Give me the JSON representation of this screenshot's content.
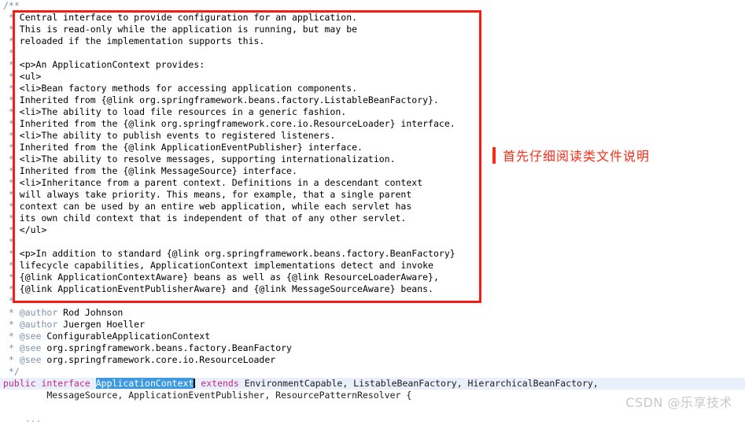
{
  "editor": {
    "language": "java",
    "font_size_px": 11.5,
    "line_height_px": 15,
    "background_color": "#ffffff",
    "comment_color": "#3f68d0",
    "comment_delim_color": "#7a8fb0",
    "javadoc_tag_color": "#8193ad",
    "keyword_color": "#c4258f",
    "selection_bg_color": "#3d9ae0",
    "selection_fg_color": "#ffffff",
    "current_line_bg_color": "#e9f0fb"
  },
  "code": {
    "open_comment": "/**",
    "close_comment": " */",
    "star": " *",
    "javadoc_lines": [
      " Central interface to provide configuration for an application.",
      " This is read-only while the application is running, but may be",
      " reloaded if the implementation supports this.",
      "",
      " <p>An ApplicationContext provides:",
      " <ul>",
      " <li>Bean factory methods for accessing application components.",
      " Inherited from {@link org.springframework.beans.factory.ListableBeanFactory}.",
      " <li>The ability to load file resources in a generic fashion.",
      " Inherited from the {@link org.springframework.core.io.ResourceLoader} interface.",
      " <li>The ability to publish events to registered listeners.",
      " Inherited from the {@link ApplicationEventPublisher} interface.",
      " <li>The ability to resolve messages, supporting internationalization.",
      " Inherited from the {@link MessageSource} interface.",
      " <li>Inheritance from a parent context. Definitions in a descendant context",
      " will always take priority. This means, for example, that a single parent",
      " context can be used by an entire web application, while each servlet has",
      " its own child context that is independent of that of any other servlet.",
      " </ul>",
      "",
      " <p>In addition to standard {@link org.springframework.beans.factory.BeanFactory}",
      " lifecycle capabilities, ApplicationContext implementations detect and invoke",
      " {@link ApplicationContextAware} beans as well as {@link ResourceLoaderAware},",
      " {@link ApplicationEventPublisherAware} and {@link MessageSourceAware} beans.",
      ""
    ],
    "javadoc_tags": [
      {
        "tag": "@author",
        "value": " Rod Johnson"
      },
      {
        "tag": "@author",
        "value": " Juergen Hoeller"
      },
      {
        "tag": "@see",
        "value": " ConfigurableApplicationContext"
      },
      {
        "tag": "@see",
        "value": " org.springframework.beans.factory.BeanFactory"
      },
      {
        "tag": "@see",
        "value": " org.springframework.core.io.ResourceLoader"
      }
    ],
    "declaration": {
      "modifier": "public",
      "type_keyword": "interface",
      "type_name": "ApplicationContext",
      "extends_keyword": "extends",
      "supertypes_line1": " EnvironmentCapable, ListableBeanFactory, HierarchicalBeanFactory,",
      "supertypes_line2": "        MessageSource, ApplicationEventPublisher, ResourcePatternResolver {"
    },
    "fold_ellipsis": "..."
  },
  "annotations": {
    "note_text": "首先仔细阅读类文件说明",
    "note_color": "#fb2c15",
    "box_color": "#f61e14"
  },
  "watermark": {
    "text": "CSDN @乐享技术"
  }
}
